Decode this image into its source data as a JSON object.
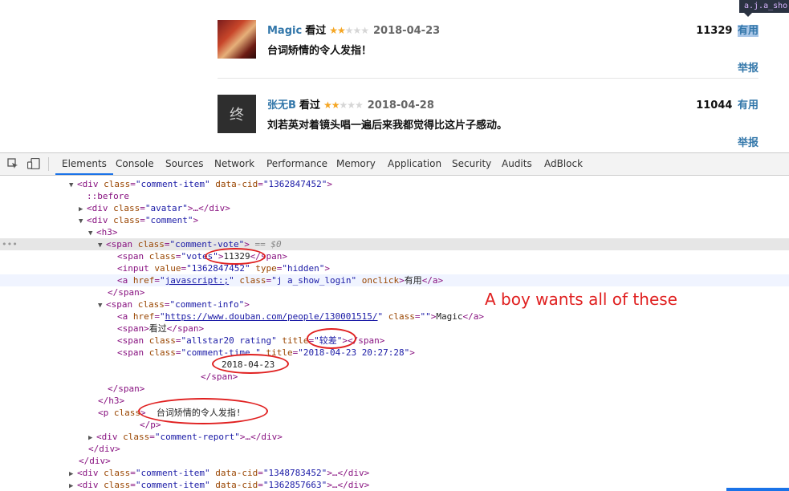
{
  "page": {
    "comments": [
      {
        "user": "Magic",
        "seen": "看过",
        "stars_on": "★★",
        "stars_off": "★★★",
        "time": "2018-04-23",
        "votes": "11329",
        "useful": "有用",
        "text": "台词矫情的令人发指！",
        "report": "举报"
      },
      {
        "user": "张无B",
        "seen": "看过",
        "stars_on": "★★",
        "stars_off": "★★★",
        "time": "2018-04-28",
        "votes": "11044",
        "useful": "有用",
        "text": "刘若英对着镜头唱一遍后来我都觉得比这片子感动。",
        "report": "举报"
      }
    ],
    "avatar2_glyph": "终",
    "tooltip": "a.j.a_sho"
  },
  "devtools": {
    "tabs": [
      "Elements",
      "Console",
      "Sources",
      "Network",
      "Performance",
      "Memory",
      "Application",
      "Security",
      "Audits",
      "AdBlock"
    ],
    "active_tab": "Elements",
    "lines": {
      "l1": {
        "open": "<div",
        "cls": "comment-item",
        "a2": "data-cid",
        "v2": "\"1362847452\"",
        "close": ">"
      },
      "l2": "::before",
      "l3": {
        "v": "\"avatar\"",
        "rest": ">…</div>"
      },
      "l4": {
        "v": "\"comment\""
      },
      "l5": "<h3>",
      "l6": {
        "v": "\"comment-vote\"",
        "eq": "== $0"
      },
      "l7": {
        "v": "\"votes\"",
        "txt": "11329",
        "end": "</span>"
      },
      "l8": {
        "v1": "\"1362847452\"",
        "v2": "\"hidden\""
      },
      "l9": {
        "href": "javascript:;",
        "cls": "\"j a_show_login\"",
        "ev": "onclick",
        "txt": "有用",
        "end": "</a>"
      },
      "l10": "</span>",
      "l11": {
        "v": "\"comment-info\""
      },
      "l12": {
        "href": "https://www.douban.com/people/130001515/",
        "cls": "\"\"",
        "txt": "Magic",
        "end": "</a>"
      },
      "l13": {
        "txt": "看过"
      },
      "l14": {
        "v": "\"allstar20 rating\"",
        "title": "\"较差\"",
        "end": "></span>"
      },
      "l15": {
        "v": "\"comment-time \"",
        "title": "\"2018-04-23 20:27:28\""
      },
      "l16": "2018-04-23",
      "l17": "</span>",
      "l18": "</span>",
      "l19": "</h3>",
      "l20": {
        "cls": "\"\"",
        "txt": "台词矫情的令人发指!"
      },
      "l21": "</p>",
      "l22": {
        "v": "\"comment-report\"",
        "rest": ">…</div>"
      },
      "l23": "</div>",
      "l24": "</div>",
      "l25": {
        "v1": "\"comment-item\"",
        "v2": "\"1348783452\""
      },
      "l26": {
        "v1": "\"comment-item\"",
        "v2": "\"1362857663\""
      }
    }
  },
  "annotation": "A boy wants all of these",
  "colors": {
    "annotation_red": "#e02020",
    "link_blue": "#3377aa",
    "star": "#f5a623",
    "tag_purple": "#881280",
    "attr_name": "#994500",
    "attr_value": "#1a1aa6"
  }
}
